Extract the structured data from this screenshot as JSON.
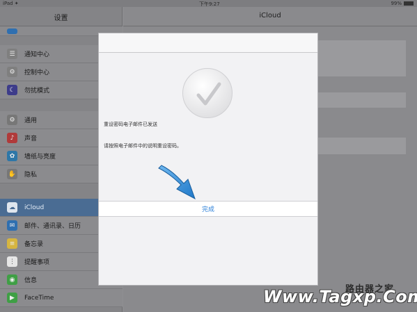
{
  "statusbar": {
    "carrier": "iPad ✦",
    "time": "下午9:27",
    "battery": "99%"
  },
  "sidebar": {
    "title": "设置",
    "groups": [
      {
        "items": [
          {
            "label": "通知中心",
            "icon": "notification-icon",
            "color": "#7f7f7f"
          },
          {
            "label": "控制中心",
            "icon": "control-center-icon",
            "color": "#7f7f7f"
          },
          {
            "label": "勿扰模式",
            "icon": "moon-icon",
            "color": "#3d3c8a"
          }
        ]
      },
      {
        "items": [
          {
            "label": "通用",
            "icon": "gear-icon",
            "color": "#777"
          },
          {
            "label": "声音",
            "icon": "sound-icon",
            "color": "#b03a3a"
          },
          {
            "label": "墙纸与亮度",
            "icon": "wallpaper-icon",
            "color": "#2e77a8"
          },
          {
            "label": "隐私",
            "icon": "hand-icon",
            "color": "#777"
          }
        ]
      },
      {
        "items": [
          {
            "label": "iCloud",
            "icon": "cloud-icon",
            "color": "#dfe6ee",
            "selected": true
          },
          {
            "label": "邮件、通讯录、日历",
            "icon": "mail-icon",
            "color": "#2f6fb0"
          },
          {
            "label": "备忘录",
            "icon": "notes-icon",
            "color": "#d6b540"
          },
          {
            "label": "提醒事项",
            "icon": "reminders-icon",
            "color": "#e6e6e6"
          },
          {
            "label": "信息",
            "icon": "messages-icon",
            "color": "#3f9f45"
          },
          {
            "label": "FaceTime",
            "icon": "facetime-icon",
            "color": "#3f9f45"
          }
        ]
      }
    ]
  },
  "rightpanel": {
    "title": "iCloud"
  },
  "modal": {
    "message1": "重设密码电子邮件已发送",
    "message2": "请按照电子邮件中的说明重设密码。",
    "done_label": "完成",
    "accent": "#2b7fd8"
  },
  "watermark": {
    "top": "路由器之家",
    "main": "Www.Tagxp.Com"
  }
}
